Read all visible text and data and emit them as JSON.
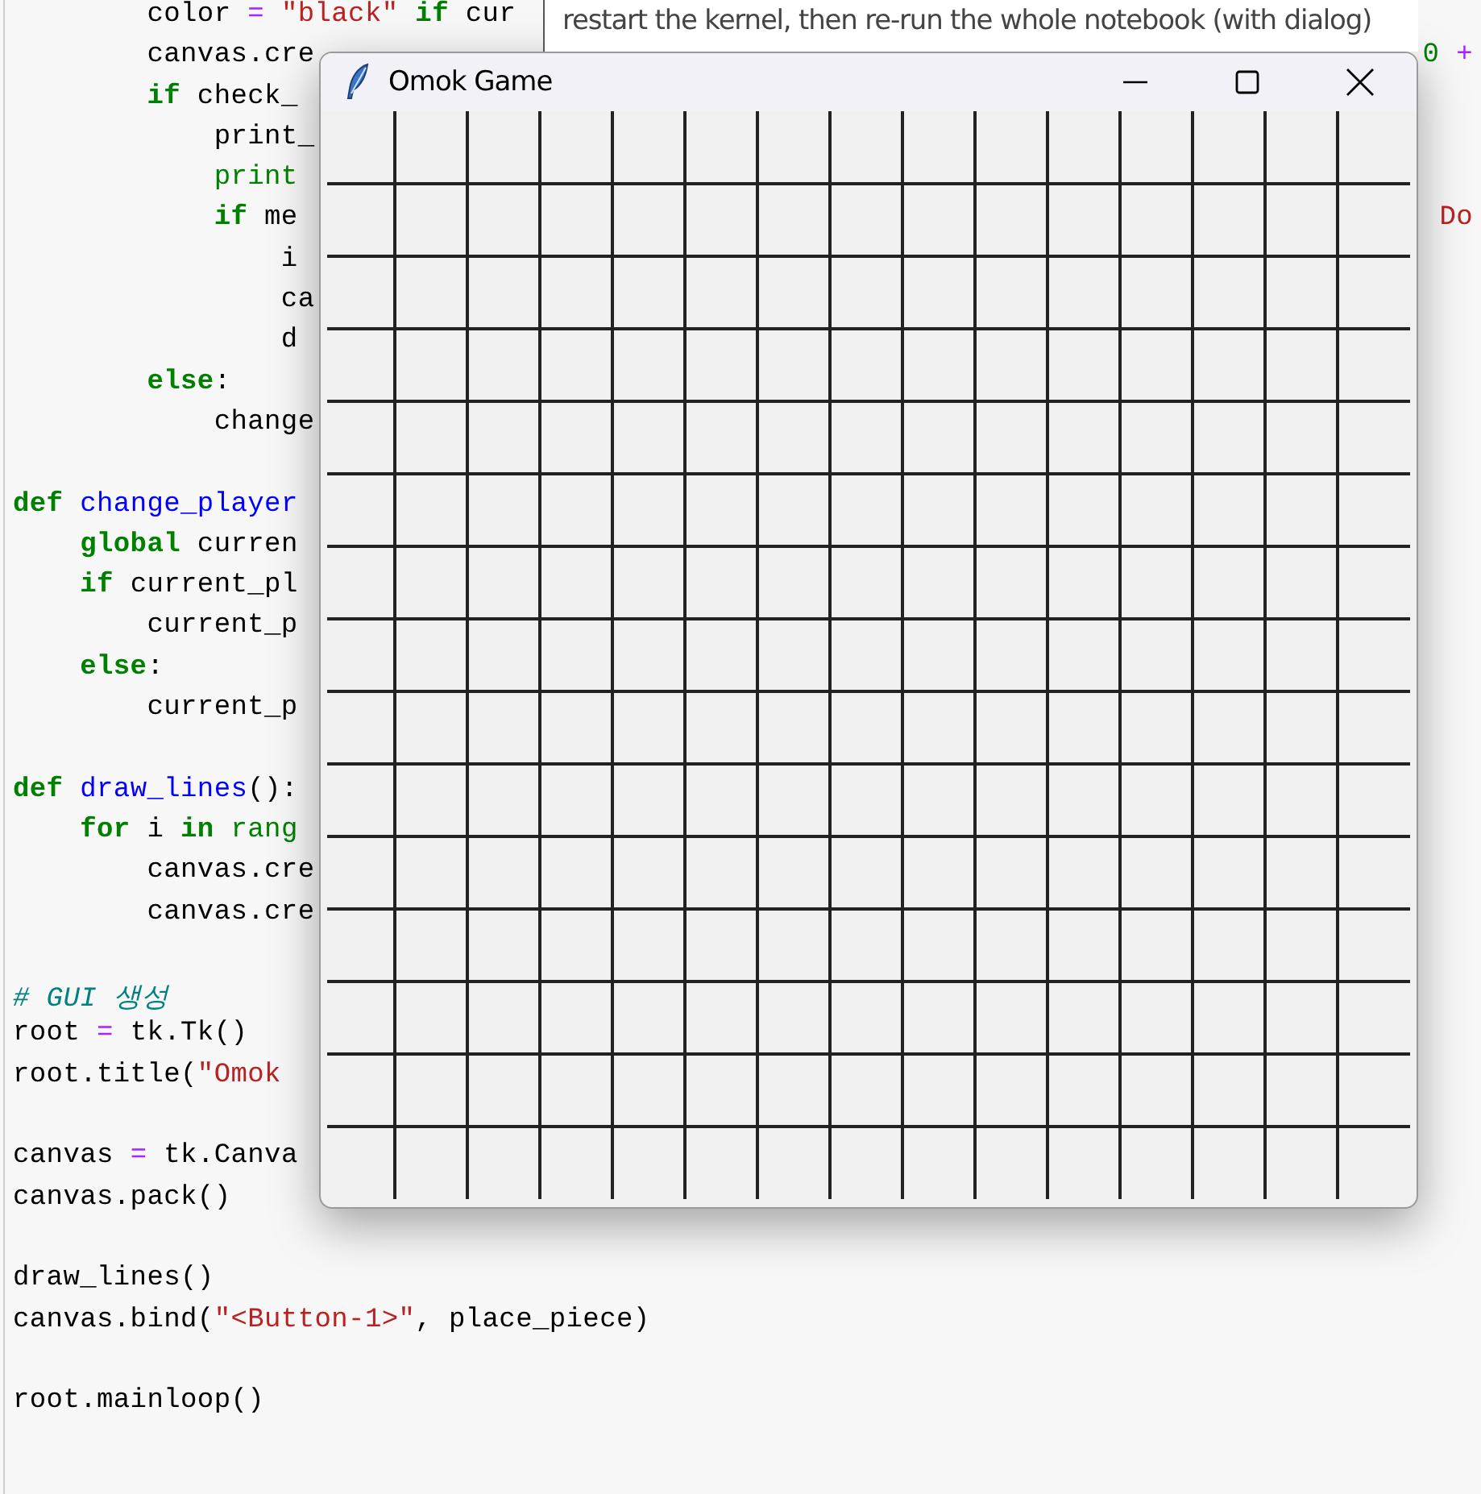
{
  "editor": {
    "lines": [
      {
        "kind": "code",
        "tokens": [
          {
            "kind": "plain",
            "text": "        color"
          },
          {
            "kind": "operator",
            "text": " ="
          },
          {
            "kind": "string",
            "text": " \"black\""
          },
          {
            "kind": "keyword",
            "text": " if"
          },
          {
            "kind": "plain",
            "text": " cur"
          }
        ]
      },
      {
        "kind": "code",
        "tokens": [
          {
            "kind": "plain",
            "text": "        canvas.cre"
          }
        ],
        "tail": [
          {
            "kind": "number",
            "text": "0"
          },
          {
            "kind": "operator",
            "text": " +"
          }
        ]
      },
      {
        "kind": "code",
        "tokens": [
          {
            "kind": "keyword",
            "text": "        if"
          },
          {
            "kind": "plain",
            "text": " check_"
          }
        ]
      },
      {
        "kind": "code",
        "tokens": [
          {
            "kind": "plain",
            "text": "            print_"
          }
        ]
      },
      {
        "kind": "code",
        "tokens": [
          {
            "kind": "builtin",
            "text": "            print"
          }
        ]
      },
      {
        "kind": "code",
        "tokens": [
          {
            "kind": "keyword",
            "text": "            if"
          },
          {
            "kind": "plain",
            "text": " me"
          }
        ],
        "tail": [
          {
            "kind": "string",
            "text": "Do"
          }
        ]
      },
      {
        "kind": "code",
        "tokens": [
          {
            "kind": "plain",
            "text": "                i"
          }
        ]
      },
      {
        "kind": "code",
        "tokens": [
          {
            "kind": "plain",
            "text": "                ca"
          }
        ]
      },
      {
        "kind": "code",
        "tokens": [
          {
            "kind": "plain",
            "text": "                d"
          }
        ]
      },
      {
        "kind": "code",
        "tokens": [
          {
            "kind": "keyword",
            "text": "        else"
          },
          {
            "kind": "plain",
            "text": ":"
          }
        ]
      },
      {
        "kind": "code",
        "tokens": [
          {
            "kind": "plain",
            "text": "            change"
          }
        ]
      },
      {
        "kind": "blank"
      },
      {
        "kind": "code",
        "tokens": [
          {
            "kind": "keyword",
            "text": "def"
          },
          {
            "kind": "function",
            "text": " change_player"
          }
        ]
      },
      {
        "kind": "code",
        "tokens": [
          {
            "kind": "keyword",
            "text": "    global"
          },
          {
            "kind": "plain",
            "text": " curren"
          }
        ]
      },
      {
        "kind": "code",
        "tokens": [
          {
            "kind": "keyword",
            "text": "    if"
          },
          {
            "kind": "plain",
            "text": " current_pl"
          }
        ]
      },
      {
        "kind": "code",
        "tokens": [
          {
            "kind": "plain",
            "text": "        current_p"
          }
        ]
      },
      {
        "kind": "code",
        "tokens": [
          {
            "kind": "keyword",
            "text": "    else"
          },
          {
            "kind": "plain",
            "text": ":"
          }
        ]
      },
      {
        "kind": "code",
        "tokens": [
          {
            "kind": "plain",
            "text": "        current_p"
          }
        ]
      },
      {
        "kind": "blank"
      },
      {
        "kind": "code",
        "tokens": [
          {
            "kind": "keyword",
            "text": "def"
          },
          {
            "kind": "function",
            "text": " draw_lines"
          },
          {
            "kind": "plain",
            "text": "():"
          }
        ]
      },
      {
        "kind": "code",
        "tokens": [
          {
            "kind": "keyword",
            "text": "    for"
          },
          {
            "kind": "plain",
            "text": " i "
          },
          {
            "kind": "keyword",
            "text": "in"
          },
          {
            "kind": "builtin",
            "text": " rang"
          }
        ]
      },
      {
        "kind": "code",
        "tokens": [
          {
            "kind": "plain",
            "text": "        canvas.cre"
          }
        ]
      },
      {
        "kind": "code",
        "tokens": [
          {
            "kind": "plain",
            "text": "        canvas.cre"
          }
        ]
      },
      {
        "kind": "blank"
      },
      {
        "kind": "code",
        "tokens": [
          {
            "kind": "comment",
            "text": "# GUI 생성"
          }
        ]
      },
      {
        "kind": "code",
        "tokens": [
          {
            "kind": "plain",
            "text": "root"
          },
          {
            "kind": "operator",
            "text": " ="
          },
          {
            "kind": "plain",
            "text": " tk.Tk()"
          }
        ]
      },
      {
        "kind": "code",
        "tokens": [
          {
            "kind": "plain",
            "text": "root.title("
          },
          {
            "kind": "string",
            "text": "\"Omok"
          }
        ]
      },
      {
        "kind": "blank"
      },
      {
        "kind": "code",
        "tokens": [
          {
            "kind": "plain",
            "text": "canvas"
          },
          {
            "kind": "operator",
            "text": " ="
          },
          {
            "kind": "plain",
            "text": " tk.Canva"
          }
        ]
      },
      {
        "kind": "code",
        "tokens": [
          {
            "kind": "plain",
            "text": "canvas.pack()"
          }
        ]
      },
      {
        "kind": "blank"
      },
      {
        "kind": "code",
        "tokens": [
          {
            "kind": "plain",
            "text": "draw_lines()"
          }
        ]
      },
      {
        "kind": "code",
        "tokens": [
          {
            "kind": "plain",
            "text": "canvas.bind("
          },
          {
            "kind": "string",
            "text": "\"<Button-1>\""
          },
          {
            "kind": "plain",
            "text": ", place_piece)"
          }
        ]
      },
      {
        "kind": "blank"
      },
      {
        "kind": "code",
        "tokens": [
          {
            "kind": "plain",
            "text": "root.mainloop()"
          }
        ]
      }
    ]
  },
  "tooltip": {
    "text": "restart the kernel, then re-run the whole notebook (with dialog)"
  },
  "window": {
    "title": "Omok Game"
  }
}
